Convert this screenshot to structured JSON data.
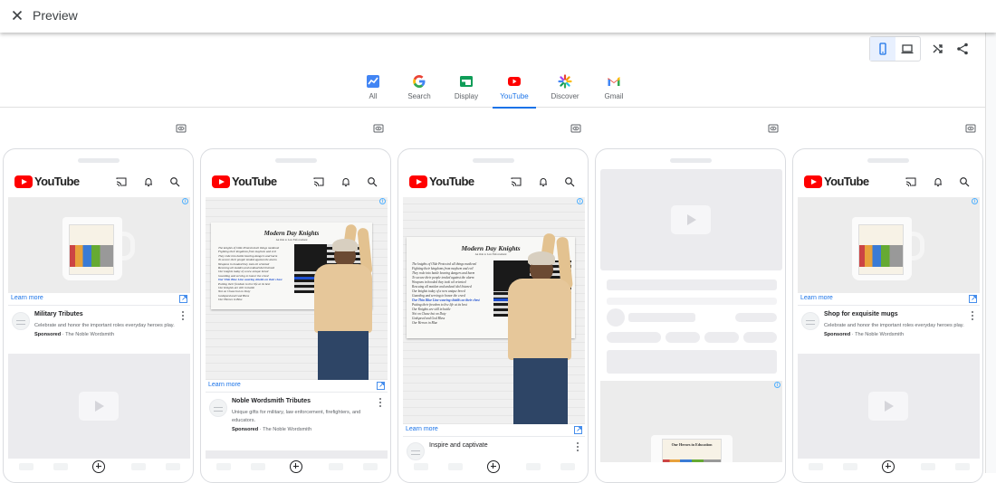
{
  "header": {
    "title": "Preview"
  },
  "tabs": [
    {
      "label": "All",
      "icon": "chart-icon",
      "active": false
    },
    {
      "label": "Search",
      "icon": "google-icon",
      "active": false
    },
    {
      "label": "Display",
      "icon": "display-icon",
      "active": false
    },
    {
      "label": "YouTube",
      "icon": "youtube-icon",
      "active": true
    },
    {
      "label": "Discover",
      "icon": "discover-icon",
      "active": false
    },
    {
      "label": "Gmail",
      "icon": "gmail-icon",
      "active": false
    }
  ],
  "youtube": {
    "logo_text": "YouTube"
  },
  "previews": [
    {
      "learn_more": "Learn more",
      "ad_title": "Military Tributes",
      "ad_desc": "Celebrate and honor the important roles everyday heroes play.",
      "sponsored": "Sponsored",
      "advertiser": "The Noble Wordsmith"
    },
    {
      "learn_more": "Learn more",
      "ad_title": "Noble Wordsmith Tributes",
      "ad_desc": "Unique gifts for military, law enforcement, firefighters, and educators.",
      "sponsored": "Sponsored",
      "advertiser": "The Noble Wordsmith"
    },
    {
      "learn_more": "Learn more",
      "ad_title": "Inspire and captivate"
    },
    {
      "mug_title": "Our Heroes in Education"
    },
    {
      "learn_more": "Learn more",
      "ad_title": "Shop for exquisite mugs",
      "ad_desc": "Celebrate and honor the important roles everyday heroes play.",
      "sponsored": "Sponsored",
      "advertiser": "The Noble Wordsmith"
    }
  ],
  "banner": {
    "title": "Modern Day Knights",
    "subtitle": "An Ode to Law Enforcement",
    "poem": [
      "The knights of Olde Protected all things medieval",
      "Fighting their kingdoms from mayhem and evil",
      "They rode into battle bearing dangers and harm",
      "To secure their people tended against the alarm",
      "Weapons in hooded they took oil oriented",
      "Rescuing all maiden and undead idol listened",
      "Our knights today of a new unique breed",
      "Guarding and serving to honor the creed",
      "Our Thin Blue Line wearing shields on their chest",
      "Putting their freedom to live life at its best",
      "Our Knights are still in battle",
      "Not on Chase but on Duty",
      "Godspeed and God Bless",
      "Our Heroes in Blue"
    ]
  },
  "mug_print_title": "Our Heroes in Education",
  "colors": {
    "accent": "#1a73e8",
    "youtube_red": "#ff0000",
    "info_blue": "#4fb0ff"
  }
}
